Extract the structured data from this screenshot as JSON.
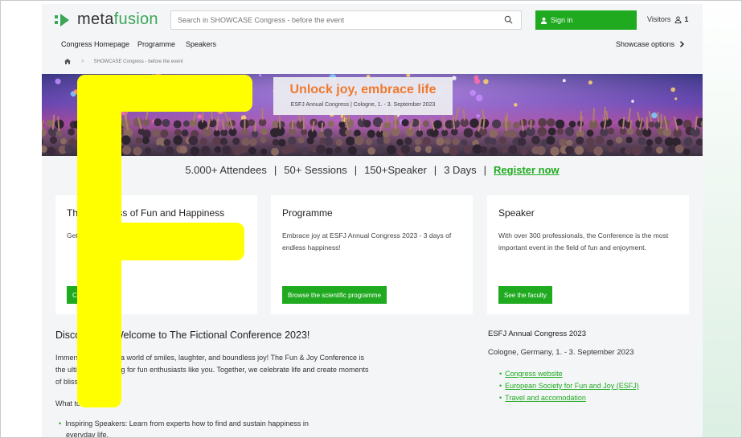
{
  "header": {
    "logo_text_1": "meta",
    "logo_text_2": "fusion",
    "search_placeholder": "Search in SHOWCASE Congress - before the event",
    "signin_label": "Sign in",
    "visitors_label": "Visitors",
    "visitors_count": "1"
  },
  "nav": {
    "items": [
      "Congress Homepage",
      "Programme",
      "Speakers"
    ],
    "showcase_options": "Showcase options"
  },
  "breadcrumb": {
    "separator": ">",
    "current": "SHOWCASE Congress - before the event"
  },
  "hero": {
    "title": "Unlock joy, embrace life",
    "subtitle": "ESFJ Annual Congress  |  Cologne, 1. - 3. September 2023"
  },
  "stats": {
    "attendees": "5.000+ Attendees",
    "sessions": "50+ Sessions",
    "speakers": "150+Speaker",
    "days": "3 Days",
    "divider": "|",
    "register": "Register now"
  },
  "cards": [
    {
      "title": "The Congress of Fun and Happiness",
      "text": "Get your tickets and join us onsite in Cologne.",
      "button": "Choose tickets"
    },
    {
      "title": "Programme",
      "text": "Embrace joy at ESFJ Annual Congress 2023 - 3 days of endless happiness!",
      "button": "Browse the scientific programme"
    },
    {
      "title": "Speaker",
      "text": "With over 300 professionals, the Conference is the most important event in the field of fun and enjoyment.",
      "button": "See the faculty"
    }
  ],
  "main": {
    "title": "Discover the Welcome to The Fictional Conference 2023!",
    "intro": "Immerse yourself in a world of smiles, laughter, and boundless joy! The Fun & Joy Conference is the ultimate gathering for fun enthusiasts like you. Together, we celebrate life and create moments of bliss.",
    "what_to_expect": "What to expect:",
    "bullets": [
      "Inspiring Speakers: Learn from experts how to find and sustain happiness in everyday life."
    ]
  },
  "sidebar": {
    "title": "ESFJ Annual Congress 2023",
    "location": "Cologne, Germany, 1. - 3. September 2023",
    "links": [
      "Congress website",
      "European Society for Fun and Joy (ESFJ)",
      "Travel and accomodation"
    ]
  },
  "colors": {
    "brand_green": "#1faa1f",
    "logo_green": "#3aa657",
    "hero_title_orange": "#ef7a2e",
    "annotation_yellow": "#ffff00"
  },
  "icons": [
    "search-icon",
    "user-icon",
    "visitor-icon",
    "chevron-right-icon",
    "home-icon"
  ]
}
